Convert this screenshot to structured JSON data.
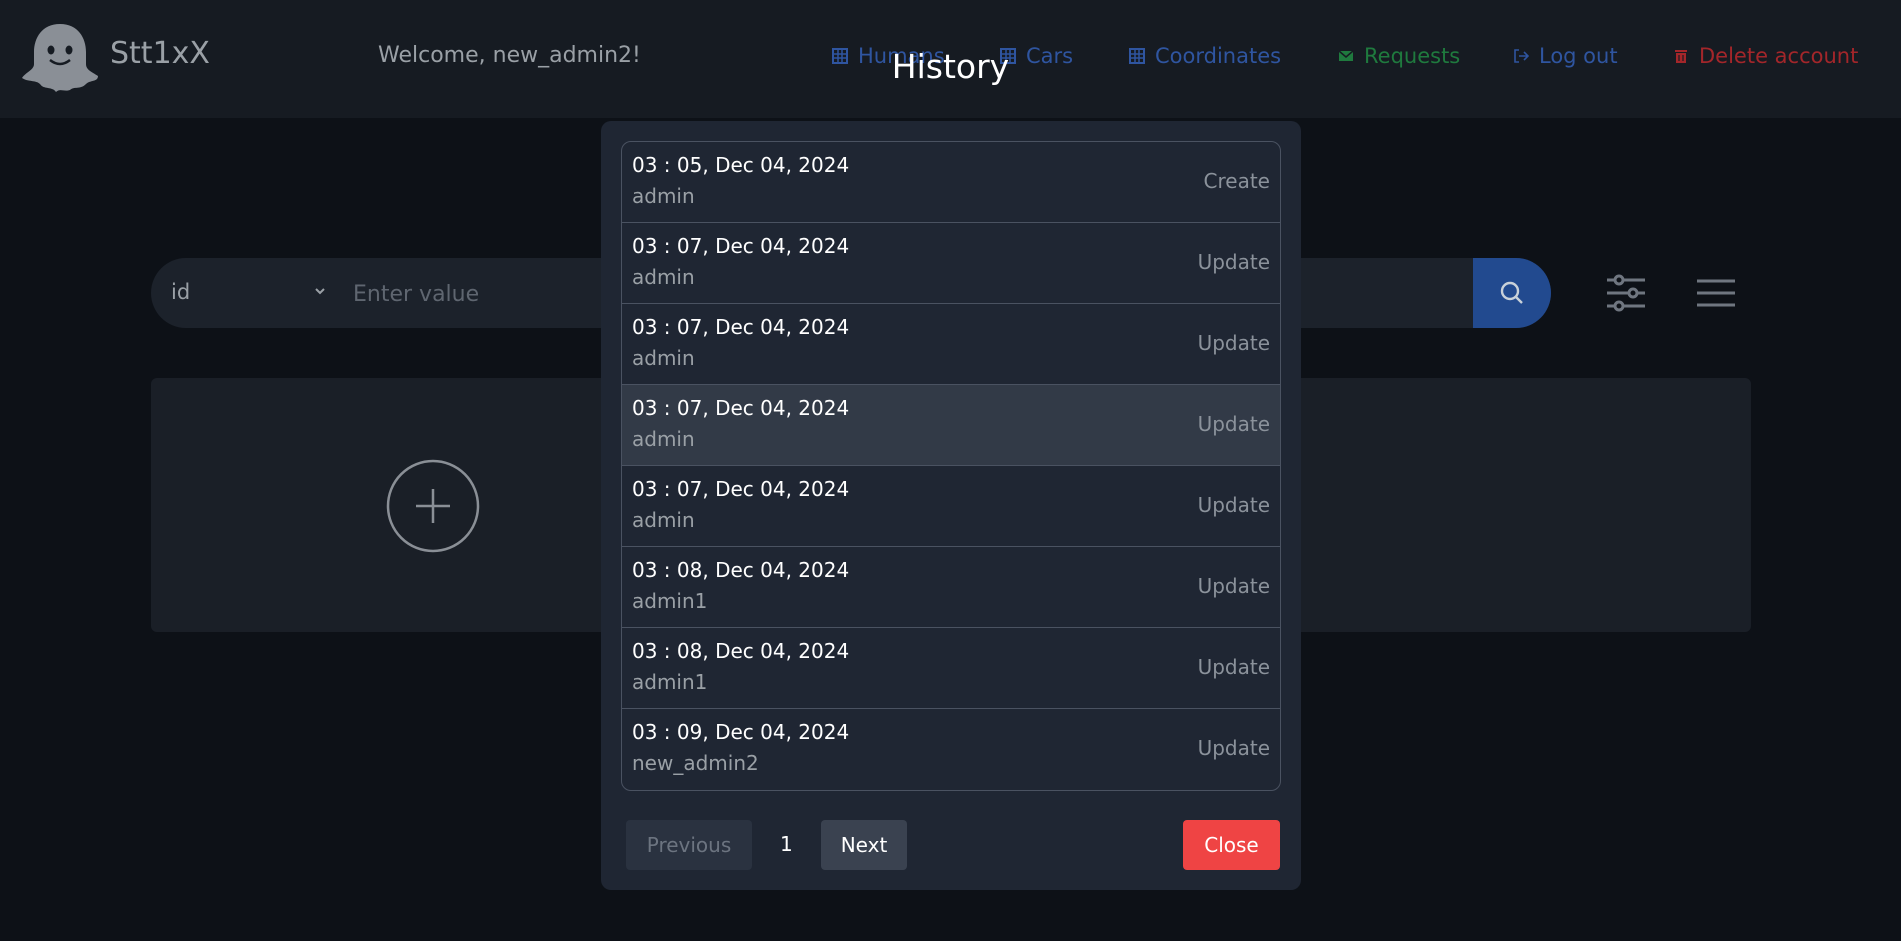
{
  "header": {
    "brand": "Stt1xX",
    "welcome": "Welcome, new_admin2!",
    "nav": {
      "humans": "Humans",
      "cars": "Cars",
      "coordinates": "Coordinates",
      "requests": "Requests",
      "logout": "Log out",
      "delete_account": "Delete account"
    }
  },
  "search": {
    "field": "id",
    "placeholder": "Enter value"
  },
  "modal": {
    "title": "History",
    "entries": [
      {
        "time": "03 : 05, Dec 04, 2024",
        "user": "admin",
        "action": "Create"
      },
      {
        "time": "03 : 07, Dec 04, 2024",
        "user": "admin",
        "action": "Update"
      },
      {
        "time": "03 : 07, Dec 04, 2024",
        "user": "admin",
        "action": "Update"
      },
      {
        "time": "03 : 07, Dec 04, 2024",
        "user": "admin",
        "action": "Update"
      },
      {
        "time": "03 : 07, Dec 04, 2024",
        "user": "admin",
        "action": "Update"
      },
      {
        "time": "03 : 08, Dec 04, 2024",
        "user": "admin1",
        "action": "Update"
      },
      {
        "time": "03 : 08, Dec 04, 2024",
        "user": "admin1",
        "action": "Update"
      },
      {
        "time": "03 : 09, Dec 04, 2024",
        "user": "new_admin2",
        "action": "Update"
      }
    ],
    "pagination": {
      "previous": "Previous",
      "page": "1",
      "next": "Next"
    },
    "close": "Close"
  },
  "colors": {
    "background": "#0d1117",
    "header": "#161b22",
    "modal": "#1f2633",
    "accent_blue": "#2f55a0",
    "accent_green": "#1f7a3e",
    "danger": "#ef4444"
  }
}
